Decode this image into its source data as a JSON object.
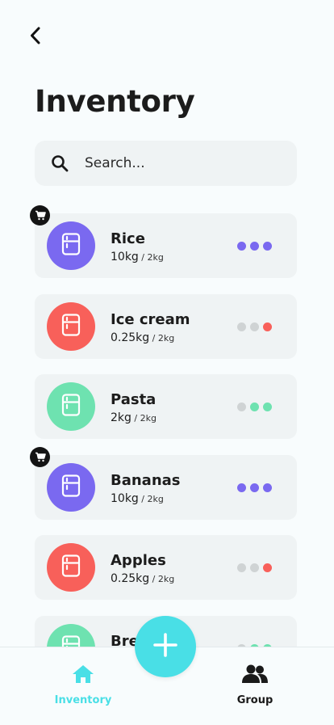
{
  "header": {
    "title": "Inventory"
  },
  "search": {
    "placeholder": "Search..."
  },
  "colors": {
    "purple": "#7a69f0",
    "red": "#f8605a",
    "green": "#6ee2b0",
    "grey": "#cfd3d4",
    "accent": "#49dfe6"
  },
  "items": [
    {
      "name": "Rice",
      "amount": "10kg",
      "capacity": "/ 2kg",
      "color": "purple",
      "in_cart": true,
      "levels": [
        "purple",
        "purple",
        "purple"
      ]
    },
    {
      "name": "Ice cream",
      "amount": "0.25kg",
      "capacity": "/ 2kg",
      "color": "red",
      "in_cart": false,
      "levels": [
        "grey",
        "grey",
        "red"
      ]
    },
    {
      "name": "Pasta",
      "amount": "2kg",
      "capacity": "/ 2kg",
      "color": "green",
      "in_cart": false,
      "levels": [
        "grey",
        "green",
        "green"
      ]
    },
    {
      "name": "Bananas",
      "amount": "10kg",
      "capacity": "/ 2kg",
      "color": "purple",
      "in_cart": true,
      "levels": [
        "purple",
        "purple",
        "purple"
      ]
    },
    {
      "name": "Apples",
      "amount": "0.25kg",
      "capacity": "/ 2kg",
      "color": "red",
      "in_cart": false,
      "levels": [
        "grey",
        "grey",
        "red"
      ]
    },
    {
      "name": "Bread",
      "amount": "",
      "capacity": "",
      "color": "green",
      "in_cart": false,
      "levels": [
        "grey",
        "green",
        "green"
      ]
    }
  ],
  "nav": {
    "inventory_label": "Inventory",
    "group_label": "Group",
    "active": "inventory"
  }
}
